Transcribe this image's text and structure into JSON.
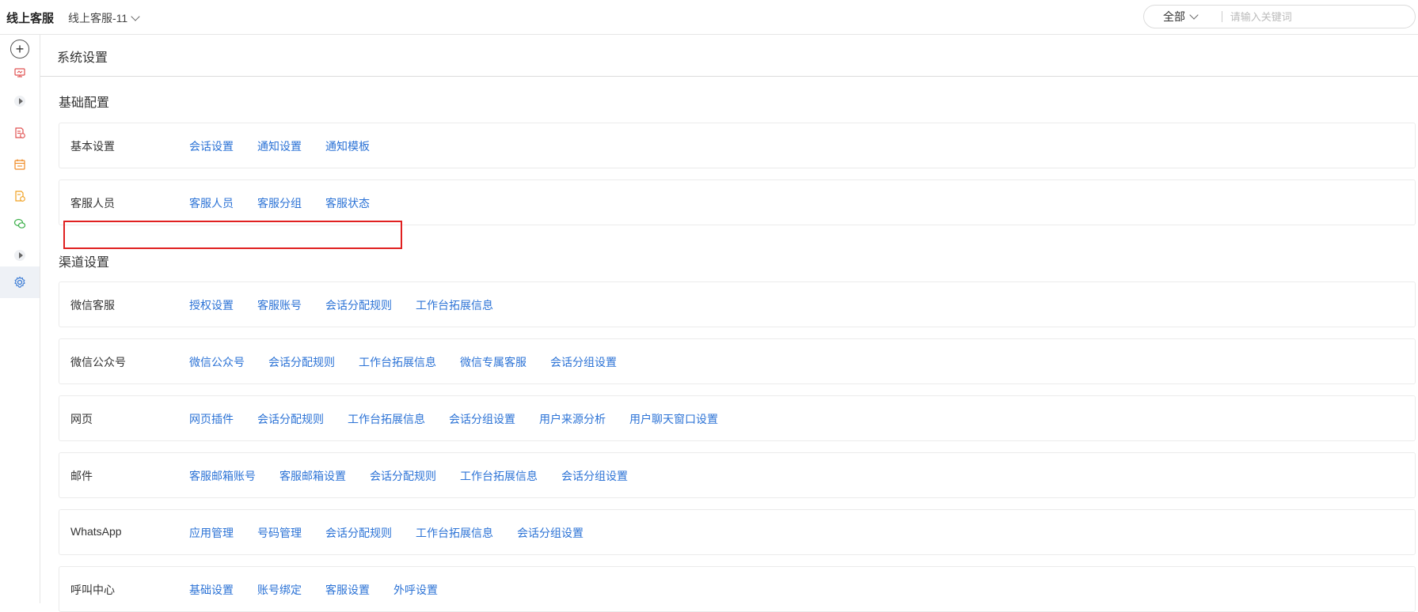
{
  "topbar": {
    "app_title": "线上客服",
    "account": "线上客服-11",
    "scope": "全部",
    "search_placeholder": "请输入关键词"
  },
  "sidebar": {
    "icons": [
      "plus-circle-icon",
      "monitor-icon",
      "expand-arrow-icon",
      "document-alert-icon",
      "calendar-icon",
      "document-settings-icon",
      "wechat-icon",
      "expand-arrow-icon",
      "gear-icon"
    ],
    "active": "gear-icon"
  },
  "page": {
    "title": "系统设置"
  },
  "sections": {
    "basic": "基础配置",
    "channels": "渠道设置"
  },
  "rows": {
    "basic_settings": {
      "label": "基本设置",
      "links": [
        "会话设置",
        "通知设置",
        "通知模板"
      ]
    },
    "agents": {
      "label": "客服人员",
      "links": [
        "客服人员",
        "客服分组",
        "客服状态"
      ]
    },
    "wecom_cs": {
      "label": "微信客服",
      "links": [
        "授权设置",
        "客服账号",
        "会话分配规则",
        "工作台拓展信息"
      ]
    },
    "wechat_mp": {
      "label": "微信公众号",
      "links": [
        "微信公众号",
        "会话分配规则",
        "工作台拓展信息",
        "微信专属客服",
        "会话分组设置"
      ]
    },
    "web": {
      "label": "网页",
      "links": [
        "网页插件",
        "会话分配规则",
        "工作台拓展信息",
        "会话分组设置",
        "用户来源分析",
        "用户聊天窗口设置"
      ]
    },
    "email": {
      "label": "邮件",
      "links": [
        "客服邮箱账号",
        "客服邮箱设置",
        "会话分配规则",
        "工作台拓展信息",
        "会话分组设置"
      ]
    },
    "whatsapp": {
      "label": "WhatsApp",
      "links": [
        "应用管理",
        "号码管理",
        "会话分配规则",
        "工作台拓展信息",
        "会话分组设置"
      ]
    },
    "call_center": {
      "label": "呼叫中心",
      "links": [
        "基础设置",
        "账号绑定",
        "客服设置",
        "外呼设置"
      ]
    }
  },
  "colors": {
    "link": "#2c73d6",
    "highlight": "#e02020",
    "active_sidebar_bg": "#eef1f6"
  }
}
